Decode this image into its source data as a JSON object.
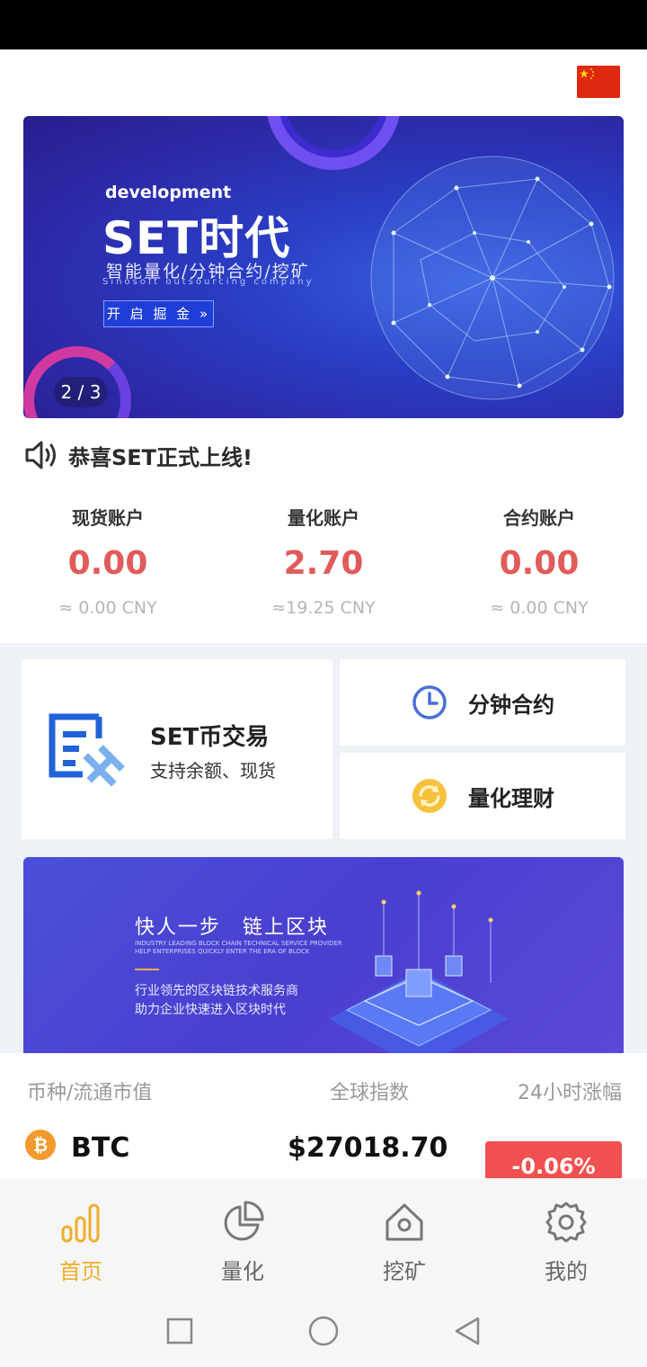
{
  "banner": {
    "subtitle": "development",
    "title": "SET时代",
    "tagline": "智能量化/分钟合约/挖矿",
    "small_text": "Sinosoft outsourcing company",
    "button_label": "开 启 掘 金 »",
    "pager": "2 / 3"
  },
  "notice": {
    "text": "恭喜SET正式上线!"
  },
  "accounts": [
    {
      "label": "现货账户",
      "value": "0.00",
      "cny": "≈ 0.00 CNY"
    },
    {
      "label": "量化账户",
      "value": "2.70",
      "cny": "≈19.25 CNY"
    },
    {
      "label": "合约账户",
      "value": "0.00",
      "cny": "≈ 0.00 CNY"
    }
  ],
  "cards": {
    "trade": {
      "title": "SET币交易",
      "desc": "支持余额、现货"
    },
    "minute_contract": {
      "label": "分钟合约"
    },
    "quant_finance": {
      "label": "量化理财"
    }
  },
  "promo": {
    "title": "快人一步　链上区块",
    "small_line1": "INDUSTRY LEADING BLOCK CHAIN TECHNICAL SERVICE PROVIDER",
    "small_line2": "HELP ENTERPRISES QUICKLY ENTER THE ERA OF BLOCK",
    "desc_line1": "行业领先的区块链技术服务商",
    "desc_line2": "助力企业快速进入区块时代"
  },
  "market": {
    "headers": [
      "币种/流通市值",
      "全球指数",
      "24小时涨幅"
    ],
    "rows": [
      {
        "symbol": "BTC",
        "logo": "₿",
        "price": "$27018.70",
        "change": "-0.06%"
      }
    ]
  },
  "tabs": [
    {
      "label": "首页",
      "icon": "bar-chart-icon",
      "active": true
    },
    {
      "label": "量化",
      "icon": "pie-chart-icon",
      "active": false
    },
    {
      "label": "挖矿",
      "icon": "mining-icon",
      "active": false
    },
    {
      "label": "我的",
      "icon": "gear-icon",
      "active": false
    }
  ],
  "colors": {
    "accent": "#f0ad2c",
    "red": "#e15b5b",
    "blue": "#2262d8"
  }
}
